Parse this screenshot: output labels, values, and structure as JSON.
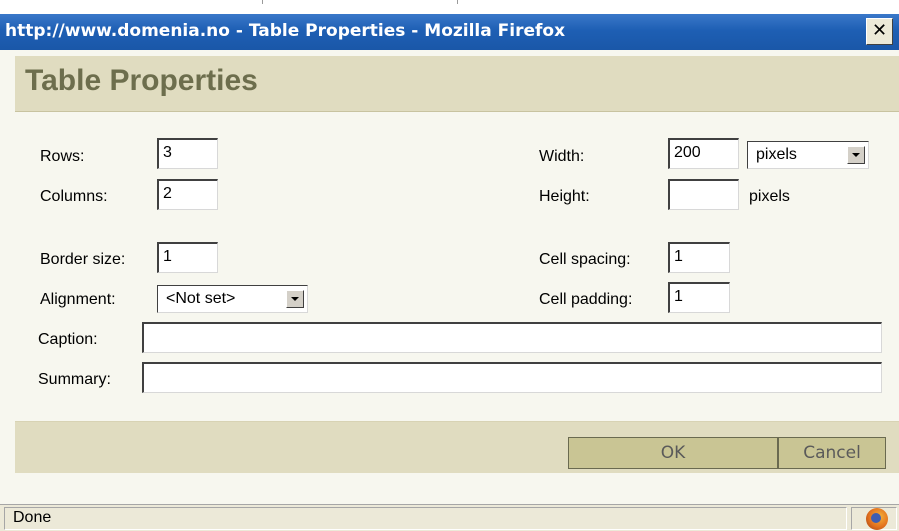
{
  "window": {
    "title": "http://www.domenia.no - Table Properties - Mozilla Firefox",
    "close_label": "✕"
  },
  "dialog": {
    "heading": "Table Properties",
    "fields": {
      "rows": {
        "label": "Rows:",
        "value": "3"
      },
      "columns": {
        "label": "Columns:",
        "value": "2"
      },
      "width": {
        "label": "Width:",
        "value": "200",
        "unit_selected": "pixels"
      },
      "height": {
        "label": "Height:",
        "value": "",
        "unit": "pixels"
      },
      "border_size": {
        "label": "Border size:",
        "value": "1"
      },
      "alignment": {
        "label": "Alignment:",
        "selected": "<Not set>"
      },
      "cell_spacing": {
        "label": "Cell spacing:",
        "value": "1"
      },
      "cell_padding": {
        "label": "Cell padding:",
        "value": "1"
      },
      "caption": {
        "label": "Caption:",
        "value": ""
      },
      "summary": {
        "label": "Summary:",
        "value": ""
      }
    },
    "buttons": {
      "ok": "OK",
      "cancel": "Cancel"
    }
  },
  "statusbar": {
    "text": "Done",
    "icon": "firefox-icon"
  },
  "colors": {
    "titlebar": "#1e5fb4",
    "header_bg": "#e0dcc0",
    "heading_text": "#6d6e4d",
    "button_bg": "#c9c594"
  }
}
